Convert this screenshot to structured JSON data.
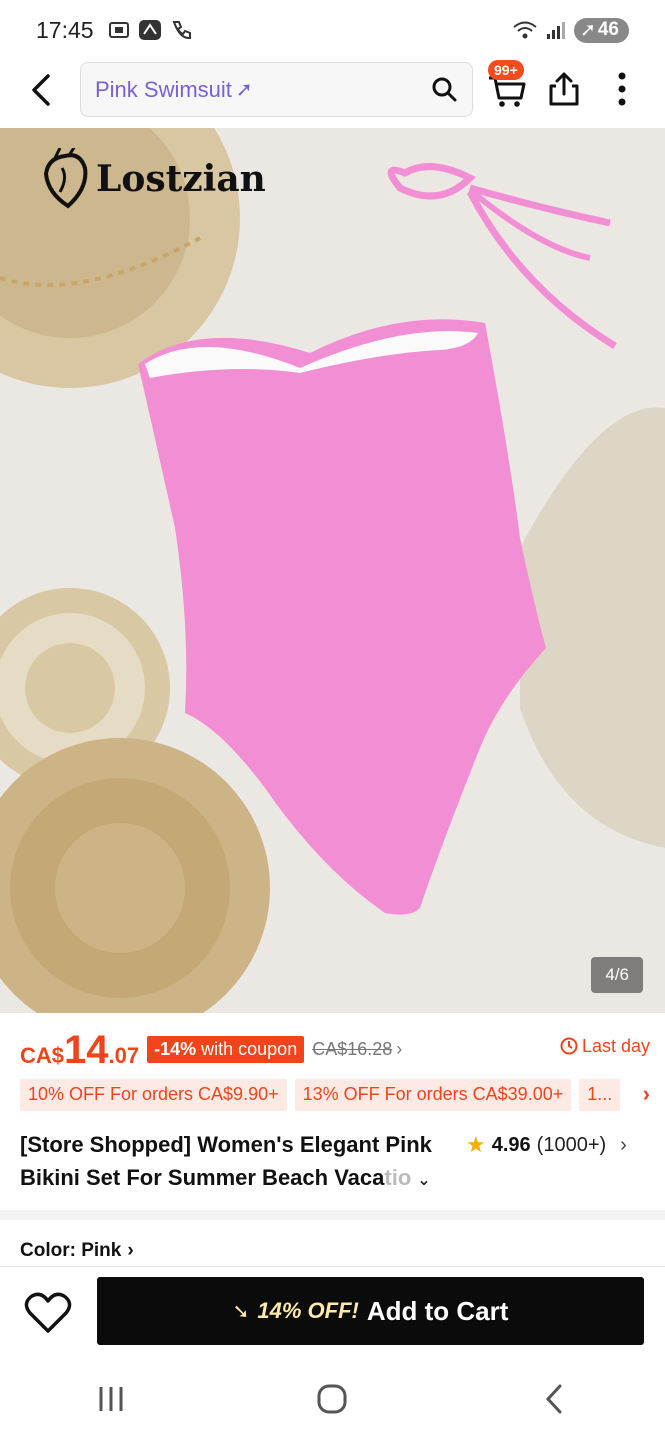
{
  "status_bar": {
    "time": "17:45",
    "battery": "46"
  },
  "search": {
    "query": "Pink Swimsuit",
    "trend_icon": "trending-arrow-icon"
  },
  "cart": {
    "badge": "99+"
  },
  "image": {
    "counter": "4/6",
    "brand": "Lostzian"
  },
  "price": {
    "currency": "CA$",
    "integer": "14",
    "decimal": ".07",
    "coupon_percent": "-14%",
    "coupon_text": " with coupon",
    "original": "CA$16.28",
    "deadline": "Last day"
  },
  "promos": [
    "10% OFF For orders CA$9.90+",
    "13% OFF For orders CA$39.00+",
    "1..."
  ],
  "product": {
    "title_line1": "[Store Shopped] Women's Elegant Pink",
    "title_line2": "Bikini Set For Summer Beach Vaca",
    "title_fade": "tio",
    "rating": "4.96",
    "rating_count": "(1000+)"
  },
  "color": {
    "label": "Color: Pink"
  },
  "bottom": {
    "discount": "14% OFF!",
    "add_to_cart": "Add to Cart"
  },
  "colors": {
    "accent": "#f2441b",
    "search_text": "#7b5fd6",
    "button_bg": "#0b0b0b",
    "star": "#f5b000"
  }
}
